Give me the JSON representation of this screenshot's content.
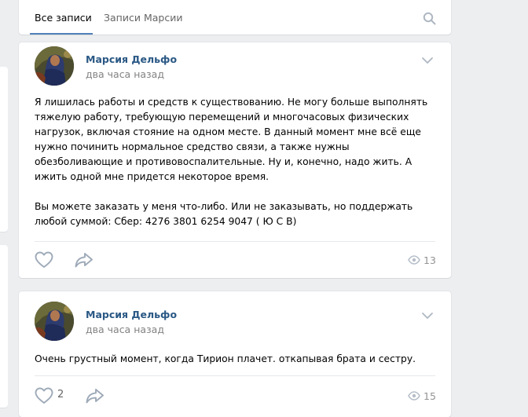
{
  "tabs": {
    "all_posts": "Все записи",
    "author_posts": "Записи Марсии"
  },
  "posts": [
    {
      "author": "Марсия Дельфо",
      "time": "два часа назад",
      "paragraph1": "Я лишилась работы и средств к существованию. Не могу больше выполнять тяжелую работу, требующую перемещений и многочасовых физических нагрузок, включая стояние на одном месте. В данный момент мне всё еще нужно починить нормальное средство связи, а также нужны обезболивающие и противовоспалительные. Ну и, конечно, надо жить. А ижить одной мне придется некоторое время.",
      "paragraph2": "Вы можете заказать у меня что-либо. Или не заказывать, но поддержать любой суммой: Сбер: 4276 3801 6254 9047 ( Ю С В)",
      "likes": "",
      "views": "13"
    },
    {
      "author": "Марсия Дельфо",
      "time": "два часа назад",
      "paragraph1": "Очень грустный момент, когда Тирион плачет. откапывая брата и сестру.",
      "likes": "2",
      "views": "15"
    }
  ],
  "colors": {
    "background": "#edeef0",
    "link": "#2a5885",
    "tab_underline": "#5181b8",
    "muted": "#828282"
  },
  "icons": [
    "search-icon",
    "chevron-down-icon",
    "heart-icon",
    "share-icon",
    "eye-icon"
  ]
}
